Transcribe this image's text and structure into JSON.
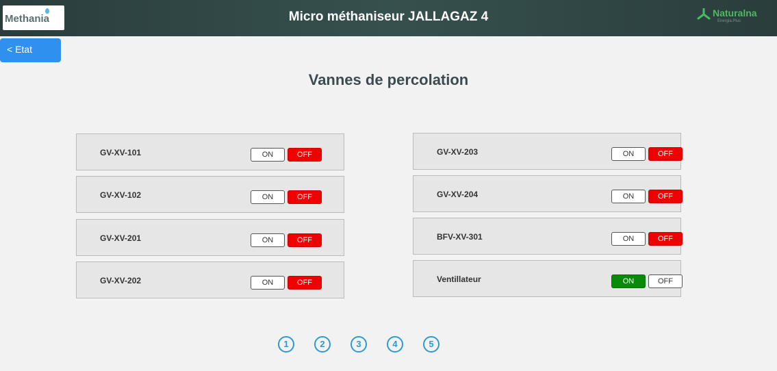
{
  "header": {
    "title": "Micro méthaniseur JALLAGAZ 4",
    "logo_left": "Methania",
    "logo_right": "Naturalna",
    "logo_right_sub": "Energia.Plus"
  },
  "nav": {
    "back_label": "< Etat"
  },
  "page": {
    "title": "Vannes de percolation"
  },
  "valves_left": [
    {
      "name": "GV-XV-101",
      "state": "OFF"
    },
    {
      "name": "GV-XV-102",
      "state": "OFF"
    },
    {
      "name": "GV-XV-201",
      "state": "OFF"
    },
    {
      "name": "GV-XV-202",
      "state": "OFF"
    }
  ],
  "valves_right": [
    {
      "name": "GV-XV-203",
      "state": "OFF"
    },
    {
      "name": "GV-XV-204",
      "state": "OFF"
    },
    {
      "name": "BFV-XV-301",
      "state": "OFF"
    },
    {
      "name": "Ventillateur",
      "state": "ON"
    }
  ],
  "toggle": {
    "on_label": "ON",
    "off_label": "OFF"
  },
  "pagination": [
    "1",
    "2",
    "3",
    "4",
    "5"
  ],
  "colors": {
    "header_bg": "#2f4544",
    "back_button": "#2f90f0",
    "off_active": "#f00000",
    "on_active": "#0a8a0a",
    "pager": "#2d9ad0",
    "brand_green": "#4fb861"
  }
}
